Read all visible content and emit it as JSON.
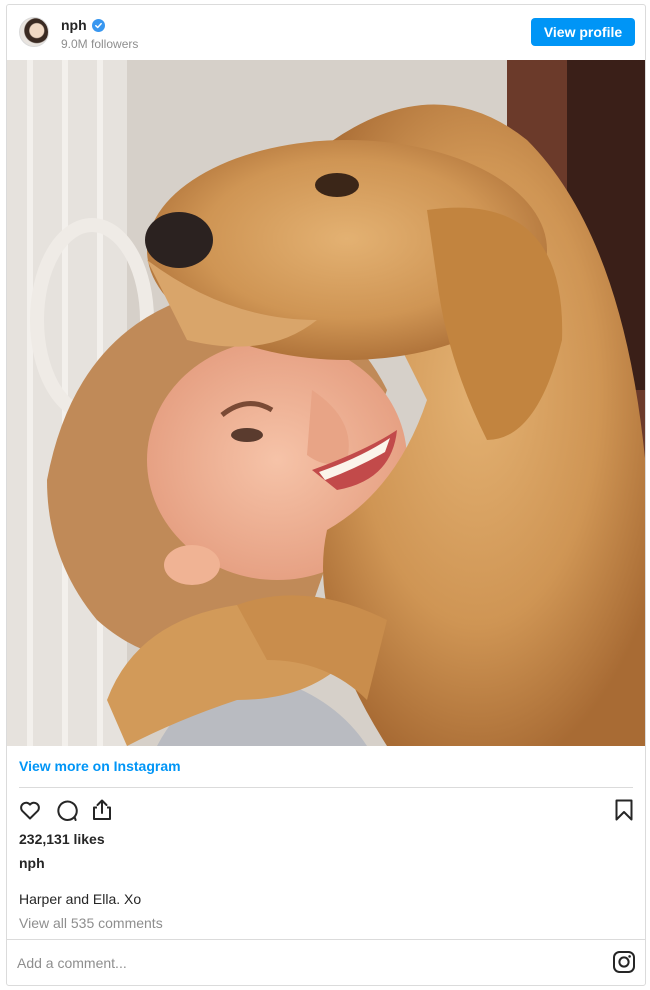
{
  "header": {
    "username": "nph",
    "followers": "9.0M followers",
    "view_profile_label": "View profile",
    "verified": true
  },
  "links": {
    "view_more": "View more on Instagram"
  },
  "post": {
    "likes": "232,131 likes",
    "caption_user": "nph",
    "caption": "Harper and Ella. Xo",
    "view_comments": "View all 535 comments"
  },
  "comment_box": {
    "placeholder": "Add a comment..."
  },
  "icons": [
    "heart-icon",
    "comment-icon",
    "share-icon",
    "bookmark-icon",
    "instagram-icon",
    "verified-icon"
  ],
  "colors": {
    "accent": "#0095f6",
    "verified": "#3897f0",
    "text": "#262626",
    "muted": "#8e8e8e",
    "border": "#dbdbdb"
  }
}
